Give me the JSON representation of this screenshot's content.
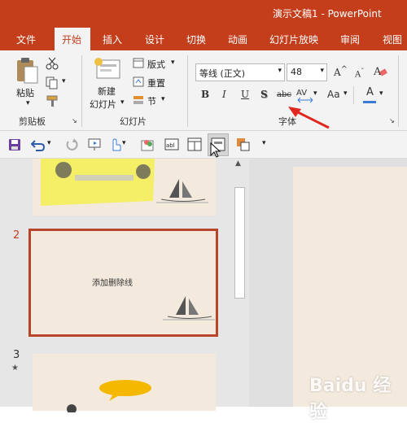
{
  "window": {
    "title": "演示文稿1  -  PowerPoint"
  },
  "tabs": [
    "文件",
    "开始",
    "插入",
    "设计",
    "切换",
    "动画",
    "幻灯片放映",
    "审阅",
    "视图"
  ],
  "ribbon": {
    "clipboard": {
      "paste": "粘贴",
      "group": "剪贴板"
    },
    "slides": {
      "new_line1": "新建",
      "new_line2": "幻灯片",
      "layout": "版式",
      "reset": "重置",
      "section": "节",
      "group": "幻灯片"
    },
    "font": {
      "name": "等线 (正文)",
      "size": "48",
      "bold": "B",
      "italic": "I",
      "underline": "U",
      "shadow": "S",
      "strike": "abc",
      "change_case": "Aa",
      "color": "A",
      "group": "字体"
    }
  },
  "thumbnails": [
    {
      "number": "",
      "text": ""
    },
    {
      "number": "2",
      "text": "添加删除线"
    },
    {
      "number": "3",
      "text": ""
    }
  ],
  "colors": {
    "brand": "#c43e1c",
    "slide_bg": "#f3e9dc",
    "highlight": "#f5f05a",
    "arrow": "#e0261f"
  },
  "watermark": "Baidu 经验"
}
